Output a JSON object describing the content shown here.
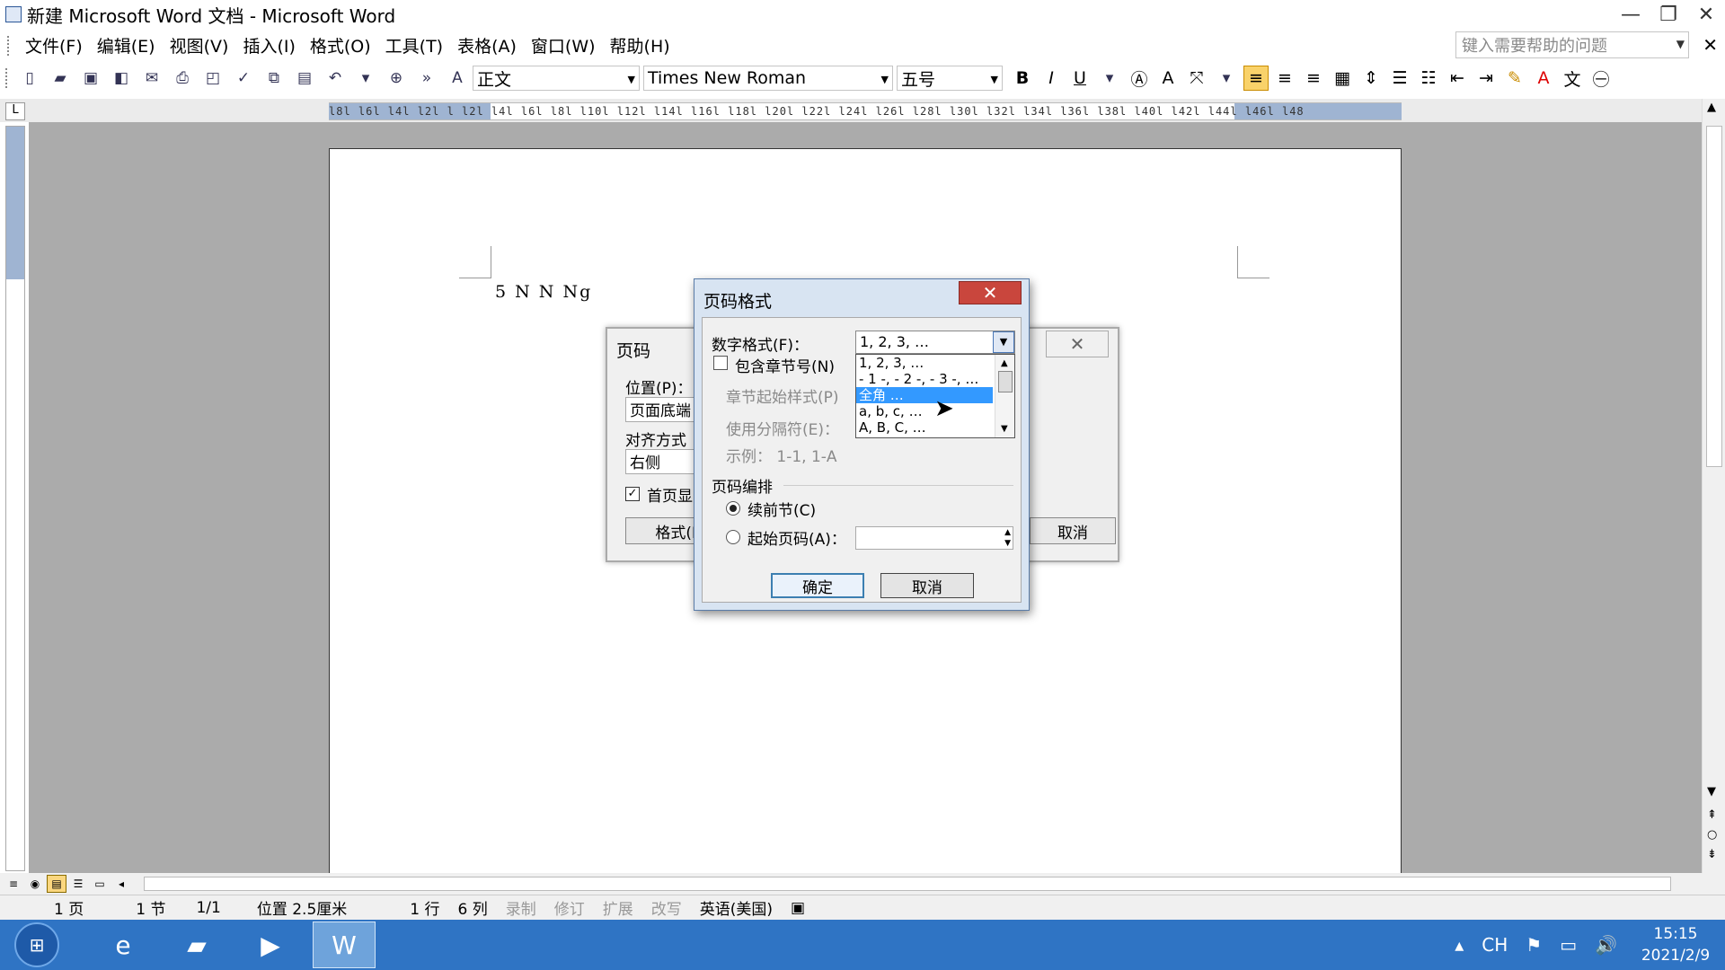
{
  "window": {
    "title": "新建 Microsoft Word 文档 - Microsoft Word",
    "minimize": "—",
    "restore": "❐",
    "close": "✕"
  },
  "menu": {
    "items": [
      "文件(F)",
      "编辑(E)",
      "视图(V)",
      "插入(I)",
      "格式(O)",
      "工具(T)",
      "表格(A)",
      "窗口(W)",
      "帮助(H)"
    ],
    "help_placeholder": "键入需要帮助的问题"
  },
  "toolbar": {
    "style": "正文",
    "font": "Times New Roman",
    "size": "五号",
    "bold": "B",
    "italic": "I",
    "underline": "U"
  },
  "ruler": {
    "ticks": "l8l l6l l4l l2l l  l2l l4l l6l l8l l10l l12l l14l l16l l18l l20l l22l l24l l26l l28l l30l l32l l34l l36l l38l l40l l42l l44l l46l l48"
  },
  "document": {
    "text": "5 N N Ng"
  },
  "dialog_bg": {
    "title": "页码",
    "position_label": "位置(P)：",
    "position_value": "页面底端",
    "align_label": "对齐方式",
    "align_value": "右侧",
    "first_page": "首页显",
    "format_button": "格式(F)...",
    "cancel_button": "取消"
  },
  "dialog": {
    "title": "页码格式",
    "number_format_label": "数字格式(F)：",
    "number_format_value": "1, 2, 3, …",
    "dropdown_options": [
      "1, 2, 3, …",
      "- 1 -, - 2 -, - 3 -, …",
      "全角 …",
      "a, b, c, …",
      "A, B, C, …"
    ],
    "selected_option_index": 2,
    "include_chapter": "包含章节号(N)",
    "chapter_start_style": "章节起始样式(P)",
    "use_separator": "使用分隔符(E)：",
    "example": "示例： 1-1, 1-A",
    "page_numbering": "页码编排",
    "continue_prev": "续前节(C)",
    "start_at": "起始页码(A)：",
    "ok": "确定",
    "cancel": "取消"
  },
  "statusbar": {
    "page": "1 页",
    "section": "1 节",
    "pages": "1/1",
    "position": "位置 2.5厘米",
    "line": "1 行",
    "column": "6 列",
    "rec": "录制",
    "trk": "修订",
    "ext": "扩展",
    "ovr": "改写",
    "language": "英语(美国)"
  },
  "taskbar": {
    "lang": "CH",
    "time": "15:15",
    "date": "2021/2/9"
  }
}
